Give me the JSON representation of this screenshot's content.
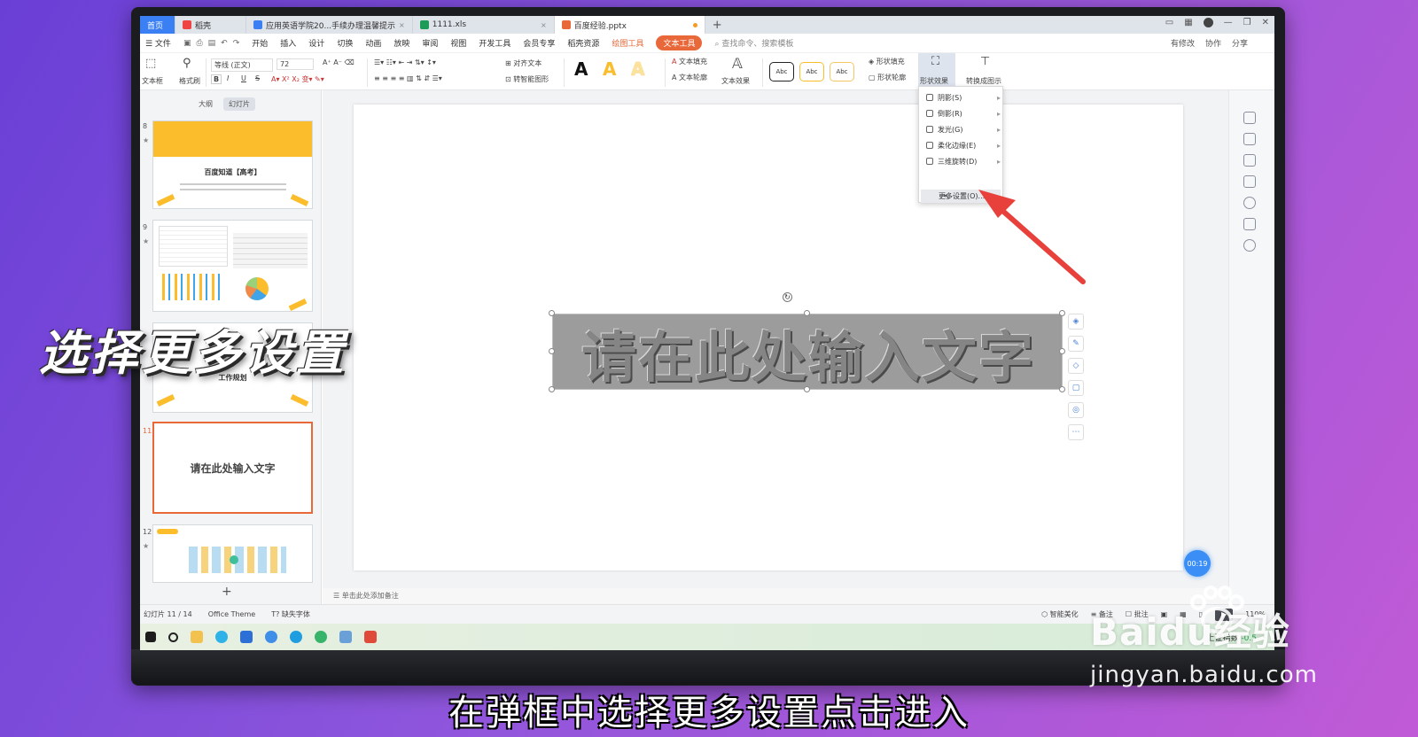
{
  "tabs": {
    "home": "首页",
    "items": [
      {
        "label": "稻壳",
        "color": "#e44"
      },
      {
        "label": "应用英语学院20...手续办理温馨提示",
        "color": "#3b7ff5"
      },
      {
        "label": "1111.xls",
        "color": "#1f9b59"
      },
      {
        "label": "百度经验.pptx",
        "color": "#e9683a"
      }
    ],
    "new_tab": "+"
  },
  "menu": {
    "file": "☰ 文件",
    "items": [
      "开始",
      "插入",
      "设计",
      "切换",
      "动画",
      "放映",
      "审阅",
      "视图",
      "开发工具",
      "会员专享",
      "稻壳资源"
    ],
    "drawing_tools": "绘图工具",
    "text_tools": "文本工具",
    "search": "查找命令、搜索模板",
    "right": [
      "有修改",
      "协作",
      "分享"
    ]
  },
  "ribbon": {
    "textbox": "文本框",
    "format_painter": "格式刷",
    "font_name": "等线 (正文)",
    "font_size": "72",
    "align_text": "对齐文本",
    "smart_shape": "转智能图形",
    "text_fill": "文本填充",
    "text_outline": "文本轮廓",
    "text_effects": "文本效果",
    "abc": "Abc",
    "shape_fill": "形状填充",
    "shape_outline": "形状轮廓",
    "shape_effects": "形状效果",
    "convert": "转换成图示",
    "bold": "B",
    "italic": "I",
    "underline": "U",
    "strike": "S"
  },
  "left_panel": {
    "tabs": [
      "大纲",
      "幻灯片"
    ],
    "slides": [
      {
        "num": "8",
        "title": "百度知道【高考】"
      },
      {
        "num": "9",
        "title": ""
      },
      {
        "num": "10",
        "title": "工作规划"
      },
      {
        "num": "11",
        "title": "请在此处输入文字"
      },
      {
        "num": "12",
        "title": ""
      }
    ],
    "add": "+"
  },
  "slide": {
    "text": "请在此处输入文字"
  },
  "notes": "单击此处添加备注",
  "dropdown": {
    "items": [
      "阴影(S)",
      "倒影(R)",
      "发光(G)",
      "柔化边缘(E)",
      "三维旋转(D)"
    ],
    "more": "更多设置(O)..."
  },
  "status": {
    "slide_count": "幻灯片 11 / 14",
    "theme": "Office Theme",
    "missing_font": "缺失字体",
    "beautify": "智能美化",
    "notes_btn": "备注",
    "comments": "批注",
    "zoom": "110%"
  },
  "taskbar": {
    "stock_label": "上证指数",
    "stock_value": "-0.5"
  },
  "timer": "00:19",
  "overlay": {
    "title": "选择更多设置",
    "subtitle": "在弹框中选择更多设置点击进入",
    "watermark_brand": "Baidu经验",
    "watermark_url": "jingyan.baidu.com"
  },
  "colors": {
    "accent": "#e9683a",
    "tab_blue": "#3b7ff5",
    "yellow": "#fbbd2b",
    "arrow_red": "#e8403a"
  }
}
